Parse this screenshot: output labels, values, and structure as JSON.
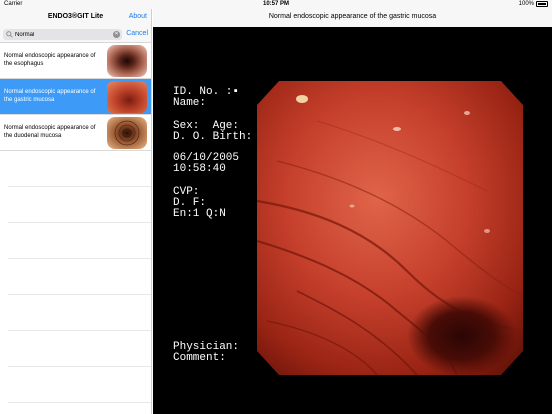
{
  "status_bar": {
    "carrier": "Carrier",
    "time": "10:57 PM",
    "battery": "100%"
  },
  "master": {
    "title": "ENDO3®GIT Lite",
    "about_label": "About",
    "search": {
      "value": "Normal",
      "cancel_label": "Cancel"
    },
    "items": [
      {
        "label": "Normal endoscopic appearance of the esophagus",
        "selected": false
      },
      {
        "label": "Normal endoscopic appearance of the gastric mucosa",
        "selected": true
      },
      {
        "label": "Normal endoscopic appearance of the duodenal mucosa",
        "selected": false
      }
    ]
  },
  "detail": {
    "title": "Normal endoscopic appearance of the gastric mucosa",
    "overlay": {
      "id_no": "ID. No. :▪",
      "name": "Name:",
      "sex_age": "Sex:  Age:",
      "dob": "D. O. Birth:",
      "date": "06/10/2005",
      "time": "10:58:40",
      "cvp": "CVP:",
      "df": "D. F:",
      "en": "En:1 Q:N",
      "physician": "Physician:",
      "comment": "Comment:"
    }
  },
  "colors": {
    "accent": "#1a7cf0",
    "selected_row": "#3d9bf7",
    "mucosa": "#c6402c"
  }
}
